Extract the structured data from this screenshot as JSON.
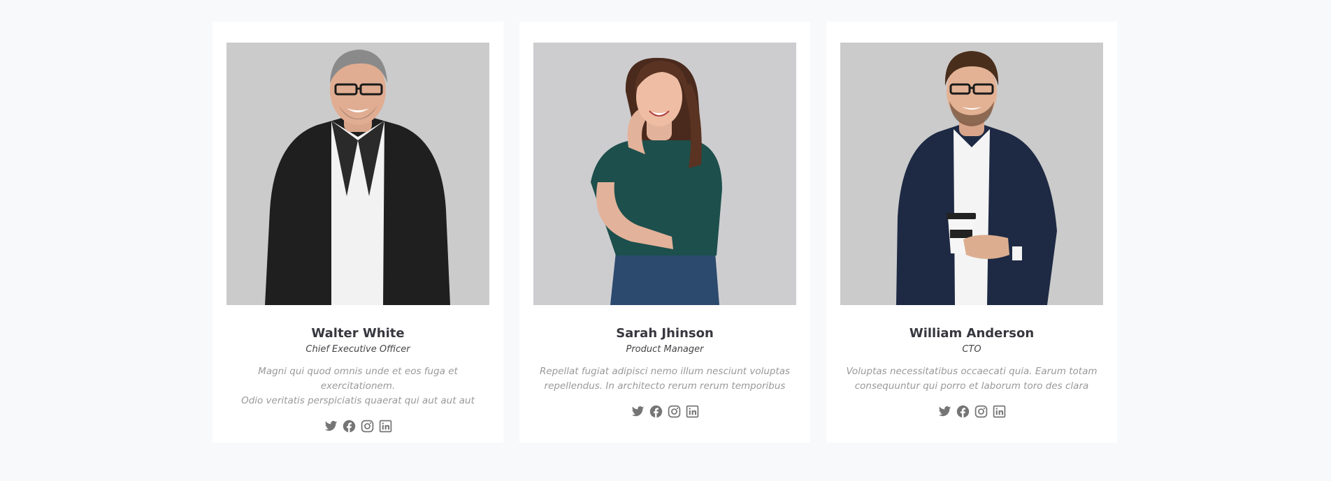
{
  "members": [
    {
      "name": "Walter White",
      "role": "Chief Executive Officer",
      "bio_line1": "Magni qui quod omnis unde et eos fuga et exercitationem.",
      "bio_line2": "Odio veritatis perspiciatis quaerat qui aut aut aut",
      "photo_icon": "man-grey-hair-black-suit-photo"
    },
    {
      "name": "Sarah Jhinson",
      "role": "Product Manager",
      "bio_line1": "Repellat fugiat adipisci nemo illum nesciunt voluptas",
      "bio_line2": "repellendus. In architecto rerum rerum temporibus",
      "photo_icon": "woman-long-hair-teal-shirt-photo"
    },
    {
      "name": "William Anderson",
      "role": "CTO",
      "bio_line1": "Voluptas necessitatibus occaecati quia. Earum totam",
      "bio_line2": "consequuntur qui porro et laborum toro des clara",
      "photo_icon": "man-navy-blazer-coffee-cup-photo"
    }
  ],
  "social_icons": [
    "twitter-icon",
    "facebook-icon",
    "instagram-icon",
    "linkedin-icon"
  ],
  "colors": {
    "page_background": "#f8f9fa",
    "card_background": "#ffffff",
    "name_text": "#37373f",
    "role_text": "#444444",
    "bio_text": "#999999",
    "social_icon": "#757575"
  }
}
